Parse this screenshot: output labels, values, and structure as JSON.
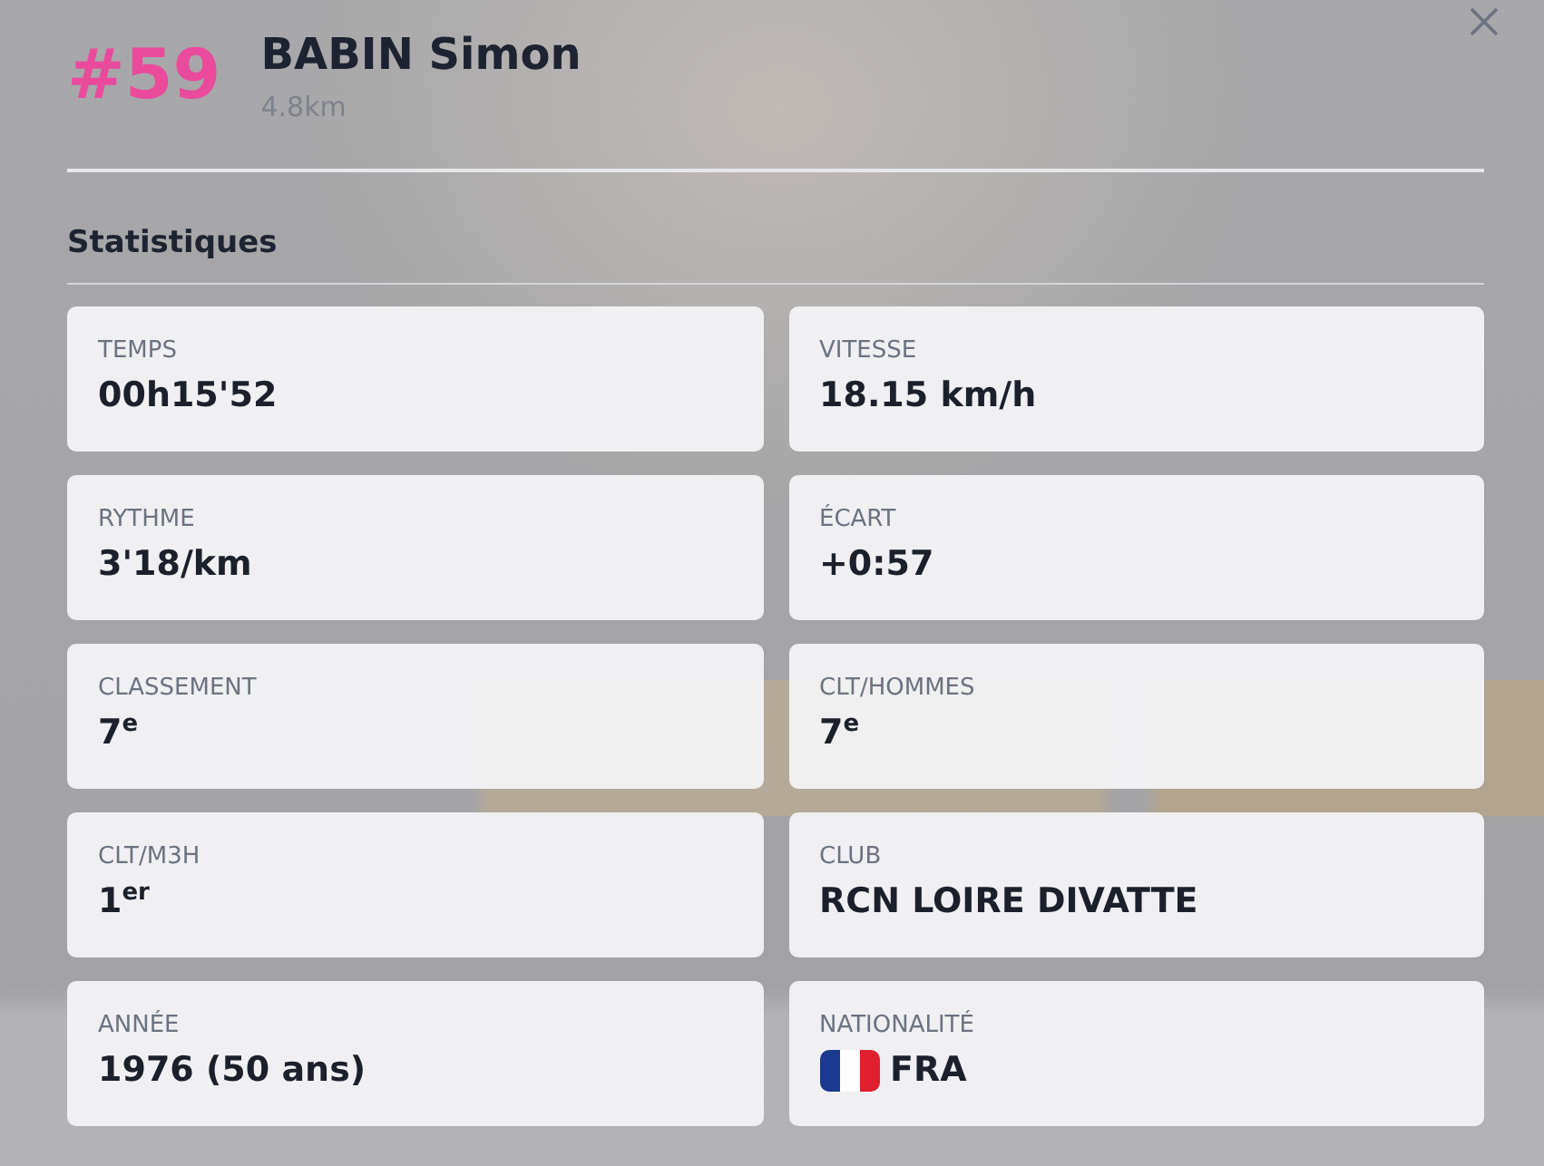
{
  "runner": {
    "bib": "#59",
    "name": "BABIN Simon",
    "distance": "4.8km"
  },
  "section": {
    "title": "Statistiques"
  },
  "stats": [
    {
      "kind": "text",
      "label": "TEMPS",
      "value": "00h15'52"
    },
    {
      "kind": "text",
      "label": "VITESSE",
      "value": "18.15 km/h"
    },
    {
      "kind": "text",
      "label": "RYTHME",
      "value": "3'18/km"
    },
    {
      "kind": "text",
      "label": "ÉCART",
      "value": "+0:57"
    },
    {
      "kind": "text",
      "label": "CLASSEMENT",
      "value": "7$^{e}$"
    },
    {
      "kind": "text",
      "label": "CLT/HOMMES",
      "value": "7$^{e}$"
    },
    {
      "kind": "text",
      "label": "CLT/M3H",
      "value": "1$^{er}$"
    },
    {
      "kind": "text",
      "label": "CLUB",
      "value": "RCN LOIRE DIVATTE"
    },
    {
      "kind": "text",
      "label": "ANNÉE",
      "value": "1976 (50 ans)"
    },
    {
      "kind": "flag",
      "label": "NATIONALITÉ",
      "value": "FRA"
    }
  ]
}
